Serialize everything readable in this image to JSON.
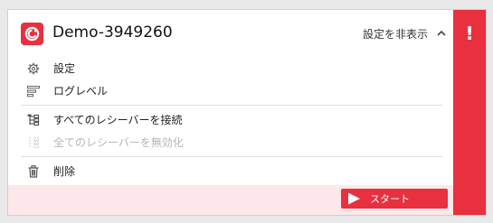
{
  "colors": {
    "accent": "#e8303f",
    "error": "#e8303f",
    "footer_bg": "#fde7ea"
  },
  "header": {
    "app_icon": "app-logo-icon",
    "title": "Demo-3949260",
    "toggle_label": "設定を非表示",
    "toggle_icon": "chevron-up-icon",
    "error_icon": "!"
  },
  "menu": {
    "items": [
      {
        "label": "設定",
        "icon": "gear-icon",
        "disabled": false
      },
      {
        "label": "ログレベル",
        "icon": "log-level-icon",
        "disabled": false
      },
      {
        "label": "すべてのレシーバーを接続",
        "icon": "connect-tree-icon",
        "disabled": false
      },
      {
        "label": "全てのレシーバーを無効化",
        "icon": "disable-tree-icon",
        "disabled": true
      },
      {
        "label": "削除",
        "icon": "trash-icon",
        "disabled": false
      }
    ]
  },
  "footer": {
    "start_label": "スタート",
    "start_icon": "play-icon"
  }
}
